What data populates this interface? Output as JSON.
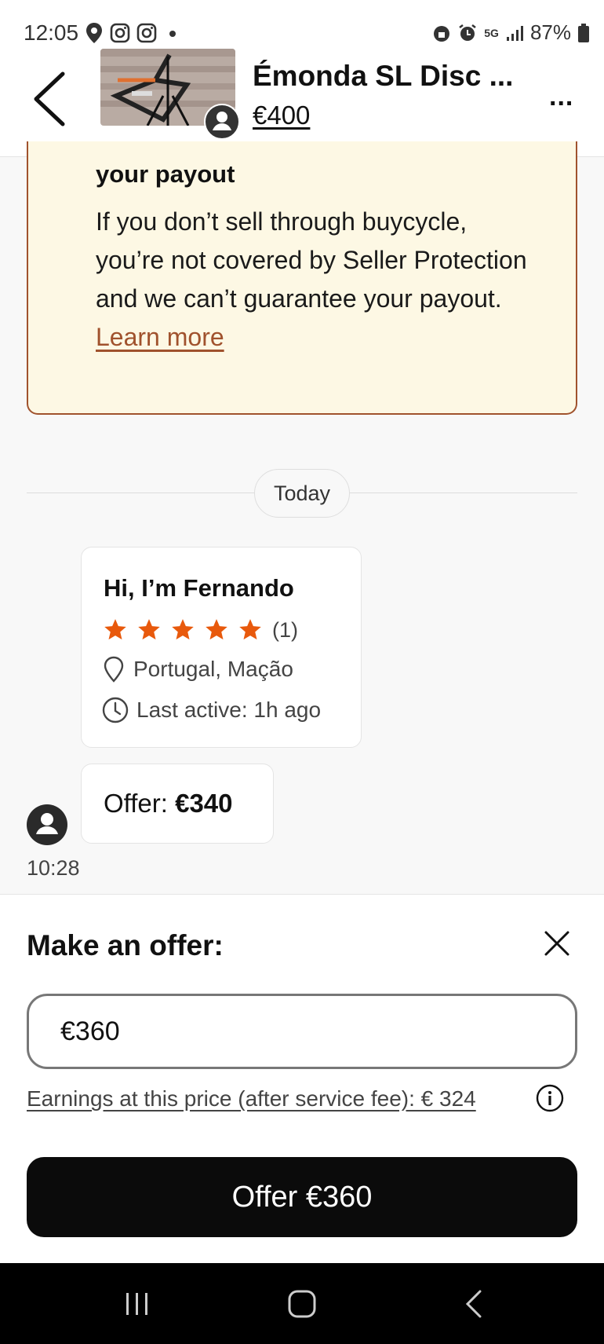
{
  "status_bar": {
    "time": "12:05",
    "battery": "87%",
    "network": "5G"
  },
  "header": {
    "title": "Émonda SL Disc ...",
    "price": "€400",
    "more": "..."
  },
  "warning": {
    "heading": "your payout",
    "body": "If you don’t sell through buycycle, you’re not covered by Seller Protection and we can’t guarantee your payout.",
    "link": "Learn more"
  },
  "chat": {
    "date_label": "Today",
    "profile": {
      "name": "Hi, I’m Fernando",
      "rating": 5,
      "rating_count": "(1)",
      "location": "Portugal, Mação",
      "last_active": "Last active: 1h ago"
    },
    "offer": {
      "label": "Offer:",
      "amount": "€340",
      "time": "10:28"
    }
  },
  "sheet": {
    "title": "Make an offer:",
    "input_value": "€360",
    "earnings": "Earnings at this price (after service fee): € 324",
    "button": "Offer €360"
  },
  "colors": {
    "star": "#e8590c",
    "warning_bg": "#fdf8e4",
    "warning_border": "#a0522d",
    "button_bg": "#0b0b0b"
  },
  "icons": [
    "location-pin-icon",
    "instagram-icon",
    "alarm-icon",
    "signal-icon",
    "battery-icon",
    "back-arrow-icon",
    "user-avatar-icon",
    "star-icon",
    "map-pin-icon",
    "clock-icon",
    "close-icon",
    "info-icon",
    "recent-apps-icon",
    "home-icon",
    "nav-back-icon"
  ]
}
